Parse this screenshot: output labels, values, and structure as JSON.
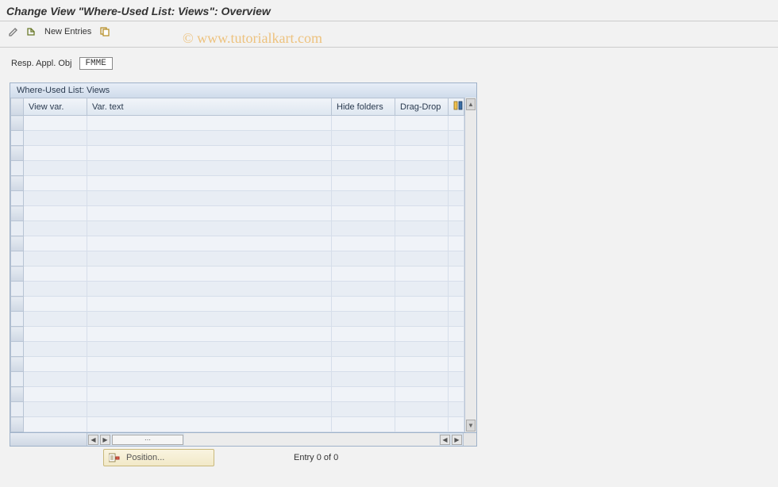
{
  "header": {
    "title": "Change View \"Where-Used List: Views\": Overview"
  },
  "toolbar": {
    "new_entries_label": "New Entries"
  },
  "filter": {
    "label": "Resp. Appl. Obj",
    "value": "FMME"
  },
  "table": {
    "title": "Where-Used List: Views",
    "columns": {
      "view_var": "View var.",
      "var_text": "Var. text",
      "hide_folders": "Hide folders",
      "drag_drop": "Drag-Drop"
    },
    "row_count_empty": 21
  },
  "footer": {
    "position_label": "Position...",
    "entry_status": "Entry 0 of 0"
  },
  "watermark": "© www.tutorialkart.com"
}
